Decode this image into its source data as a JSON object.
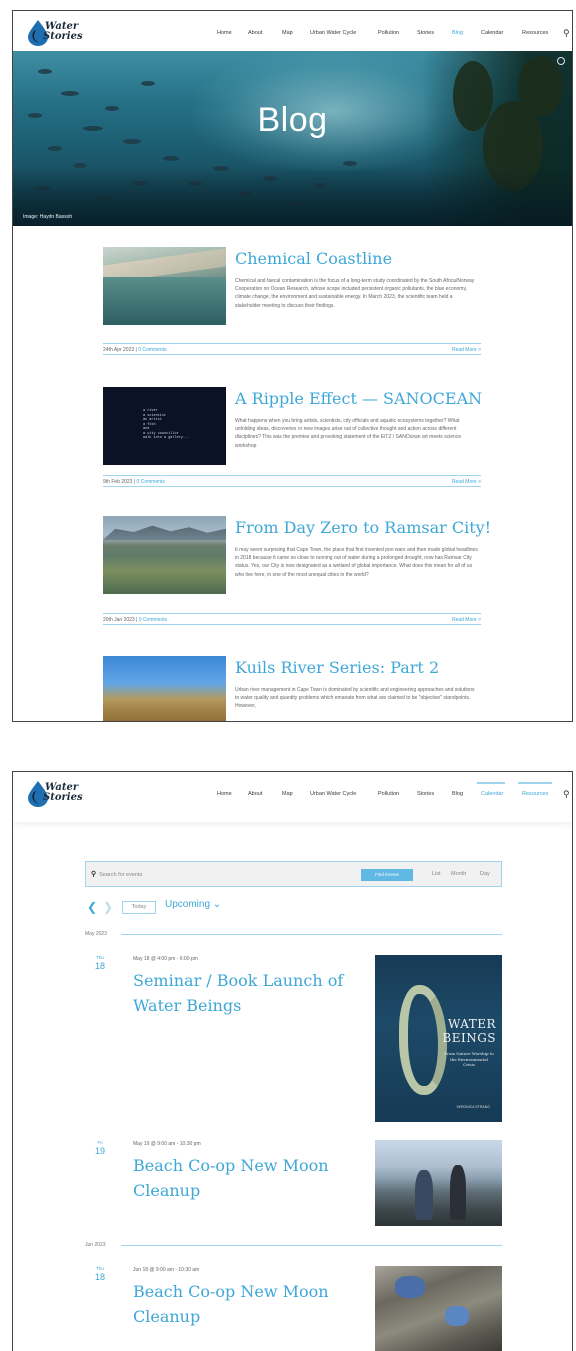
{
  "brand": {
    "line1": "Water",
    "line2": "Stories",
    "accent": "#3ea7d8"
  },
  "nav": {
    "items": [
      "Home",
      "About",
      "Map",
      "Urban Water Cycle",
      "Pollution",
      "Stories",
      "Blog",
      "Calendar",
      "Resources"
    ],
    "active_blog_page": "Blog",
    "active_events_page": "Resources",
    "search_icon": "search-icon"
  },
  "hero": {
    "title": "Blog",
    "credit": "Image: Haydn Bassoh"
  },
  "posts": [
    {
      "title": "Chemical Coastline",
      "excerpt": "Chemical and faecal contamination is the focus of a long-term study coordinated by the South Africa/Norway Cooperation on Ocean Research, whose scope included persistent organic pollutants, the blue economy, climate change, the environment and sustainable energy. In March 2023, the scientific team held a stakeholder meeting to discuss their findings.",
      "date": "24th Apr 2023",
      "comments": "0 Comments",
      "read_more": "Read More >"
    },
    {
      "title": "A Ripple Effect — SANOCEAN",
      "excerpt": "What happens when you bring artists, scientists, city officials and aquatic ecosystems together? What unfolding ideas, discoveries or new images arise out of collective thought and action across different disciplines? This was the premise and provoking statement of the EiTZ / SANOcean art meets science workshop",
      "date": "9th Feb 2023",
      "comments": "0 Comments",
      "read_more": "Read More >",
      "thumb_text": "a river\na scientist\nan artist\na fish\nand\na city councillor\nwalk into a gallery..."
    },
    {
      "title": "From Day Zero to Ramsar City!",
      "excerpt": "It may seem surprising that Cape Town, the place that first invented poo wars and then made global headlines in 2018 because it came so close to running out of water during a prolonged drought, now has Ramsar City status. Yes, our City is now designated as a wetland of global importance. What does this mean for all of us who live here, in one of the most unequal cities in the world?",
      "date": "20th Jan 2023",
      "comments": "0 Comments",
      "read_more": "Read More >"
    },
    {
      "title": "Kuils River Series: Part 2",
      "excerpt": "Urban river management in Cape Town is dominated by scientific and engineering approaches and solutions to water quality and quantity problems which emanate from what are claimed to be \"objective\" standpoints. However,"
    }
  ],
  "events": {
    "search_placeholder": "Search for events",
    "find_button": "Find Events",
    "views": [
      "List",
      "Month",
      "Day"
    ],
    "today": "Today",
    "upcoming": "Upcoming ⌄",
    "months": [
      "May 2023",
      "Jun 2023"
    ],
    "items": [
      {
        "dow": "Thu",
        "day": "18",
        "when": "May 18 @ 4:00 pm - 6:00 pm",
        "title": "Seminar / Book Launch of Water Beings",
        "book": {
          "line1": "WATER",
          "line2": "BEINGS",
          "subtitle": "From Nature Worship to the Environmental Crisis",
          "author": "VERONICA STRANG"
        }
      },
      {
        "dow": "Fri",
        "day": "19",
        "when": "May 19 @ 9:00 am - 10:30 pm",
        "title": "Beach Co-op New Moon Cleanup"
      },
      {
        "dow": "Thu",
        "day": "18",
        "when": "Jun 18 @ 9:00 am - 10:30 am",
        "title": "Beach Co-op New Moon Cleanup"
      }
    ]
  }
}
